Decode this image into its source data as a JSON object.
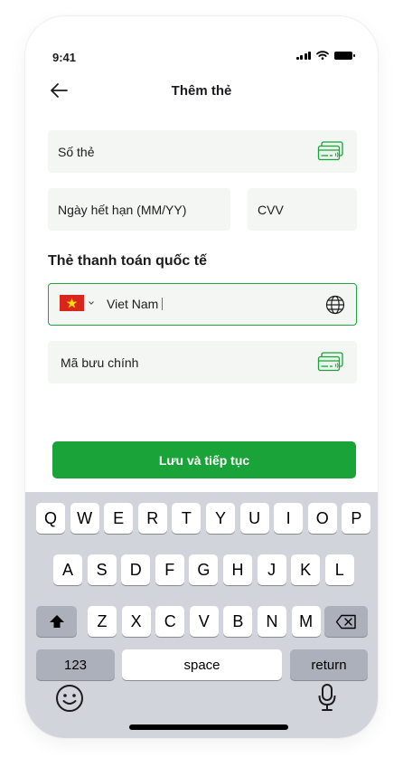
{
  "status_bar": {
    "time": "9:41"
  },
  "header": {
    "title": "Thêm thẻ"
  },
  "form": {
    "card_number": {
      "placeholder": "Số thẻ"
    },
    "expiry": {
      "placeholder": "Ngày hết hạn (MM/YY)"
    },
    "cvv": {
      "placeholder": "CVV"
    },
    "section_title": "Thẻ thanh toán quốc tế",
    "country": {
      "value": "Viet Nam",
      "flag": "vietnam-flag"
    },
    "postal_code": {
      "placeholder": "Mã bưu chính"
    }
  },
  "primary_button": {
    "label": "Lưu và tiếp tục"
  },
  "accent_color": "#1aa338",
  "keyboard": {
    "row1": [
      "Q",
      "W",
      "E",
      "R",
      "T",
      "Y",
      "U",
      "I",
      "O",
      "P"
    ],
    "row2": [
      "A",
      "S",
      "D",
      "F",
      "G",
      "H",
      "J",
      "K",
      "L"
    ],
    "row3": [
      "Z",
      "X",
      "C",
      "V",
      "B",
      "N",
      "M"
    ],
    "numbers_label": "123",
    "space_label": "space",
    "return_label": "return"
  }
}
